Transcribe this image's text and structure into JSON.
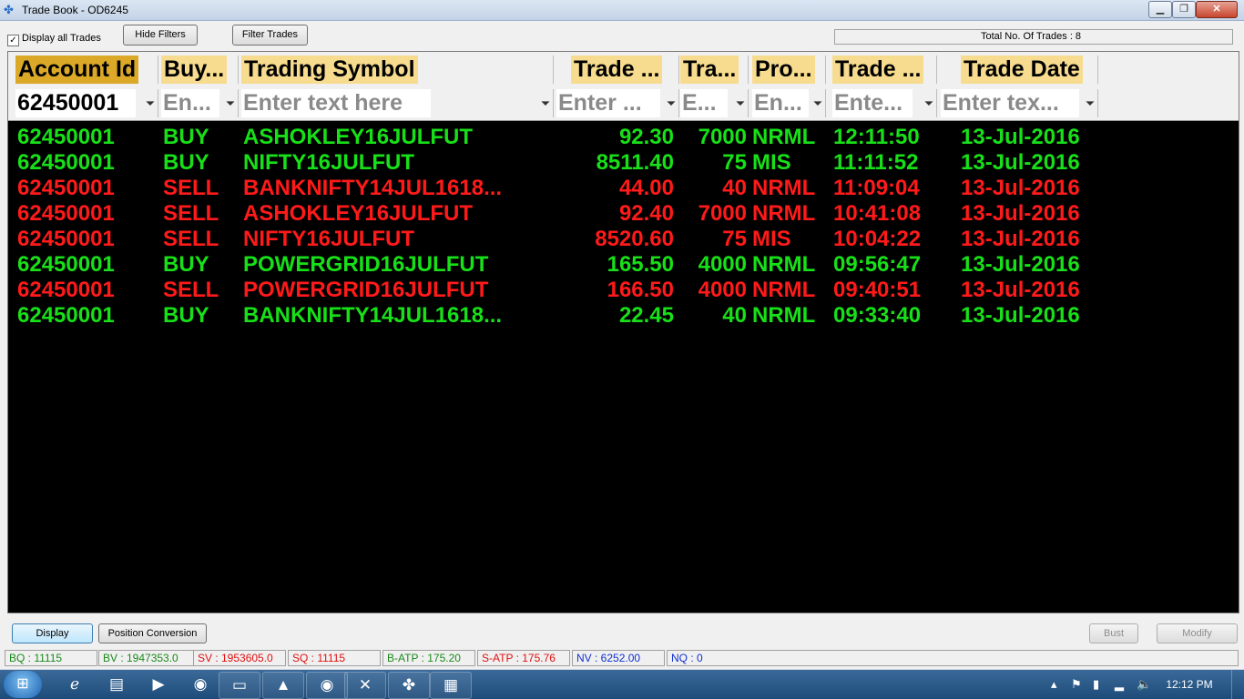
{
  "window": {
    "title": "Trade Book - OD6245"
  },
  "toolbar": {
    "display_all_label": "Display all Trades",
    "display_all_checked": true,
    "hide_filters_label": "Hide Filters",
    "filter_trades_label": "Filter Trades",
    "total_trades_label": "Total No. Of Trades : 8"
  },
  "grid": {
    "columns": [
      "Account Id",
      "Buy...",
      "Trading Symbol",
      "Trade ...",
      "Tra...",
      "Pro...",
      "Trade ...",
      "Trade Date"
    ],
    "filters": [
      "62450001",
      "En...",
      "Enter text here",
      "Enter ...",
      "E...",
      "En...",
      "Ente...",
      "Enter tex..."
    ],
    "rows": [
      {
        "side_class": "buy",
        "cells": [
          "62450001",
          "BUY",
          "ASHOKLEY16JULFUT",
          "92.30",
          "7000",
          "NRML",
          "12:11:50",
          "13-Jul-2016"
        ]
      },
      {
        "side_class": "buy",
        "cells": [
          "62450001",
          "BUY",
          "NIFTY16JULFUT",
          "8511.40",
          "75",
          "MIS",
          "11:11:52",
          "13-Jul-2016"
        ]
      },
      {
        "side_class": "sell",
        "cells": [
          "62450001",
          "SELL",
          "BANKNIFTY14JUL1618...",
          "44.00",
          "40",
          "NRML",
          "11:09:04",
          "13-Jul-2016"
        ]
      },
      {
        "side_class": "sell",
        "cells": [
          "62450001",
          "SELL",
          "ASHOKLEY16JULFUT",
          "92.40",
          "7000",
          "NRML",
          "10:41:08",
          "13-Jul-2016"
        ]
      },
      {
        "side_class": "sell",
        "cells": [
          "62450001",
          "SELL",
          "NIFTY16JULFUT",
          "8520.60",
          "75",
          "MIS",
          "10:04:22",
          "13-Jul-2016"
        ]
      },
      {
        "side_class": "buy",
        "cells": [
          "62450001",
          "BUY",
          "POWERGRID16JULFUT",
          "165.50",
          "4000",
          "NRML",
          "09:56:47",
          "13-Jul-2016"
        ]
      },
      {
        "side_class": "sell",
        "cells": [
          "62450001",
          "SELL",
          "POWERGRID16JULFUT",
          "166.50",
          "4000",
          "NRML",
          "09:40:51",
          "13-Jul-2016"
        ]
      },
      {
        "side_class": "buy",
        "cells": [
          "62450001",
          "BUY",
          "BANKNIFTY14JUL1618...",
          "22.45",
          "40",
          "NRML",
          "09:33:40",
          "13-Jul-2016"
        ]
      }
    ]
  },
  "actions": {
    "display_label": "Display",
    "position_conversion_label": "Position Conversion",
    "bust_label": "Bust",
    "modify_label": "Modify"
  },
  "status": [
    {
      "text": "BQ : 11115",
      "color": "#1a8a1a"
    },
    {
      "text": "BV : 1947353.0",
      "color": "#1a8a1a"
    },
    {
      "text": "SV : 1953605.0",
      "color": "#e01010"
    },
    {
      "text": "SQ : 11115",
      "color": "#e01010"
    },
    {
      "text": "B-ATP : 175.20",
      "color": "#1a8a1a"
    },
    {
      "text": "S-ATP : 175.76",
      "color": "#e01010"
    },
    {
      "text": "NV : 6252.00",
      "color": "#1030d0"
    },
    {
      "text": "NQ : 0",
      "color": "#1030d0"
    }
  ],
  "taskbar": {
    "icons": [
      "windows-start-icon",
      "internet-explorer-icon",
      "file-explorer-icon",
      "media-player-icon",
      "chrome-icon",
      "app-icon",
      "triangle-app-icon",
      "chrome-pinned-icon",
      "excel-icon",
      "puzzle-app-icon",
      "calculator-icon"
    ],
    "clock": "12:12 PM"
  },
  "colors": {
    "buy": "#18e018",
    "sell": "#ff1a1a",
    "header": "#f7dc8f",
    "header_selected": "#dba927"
  }
}
